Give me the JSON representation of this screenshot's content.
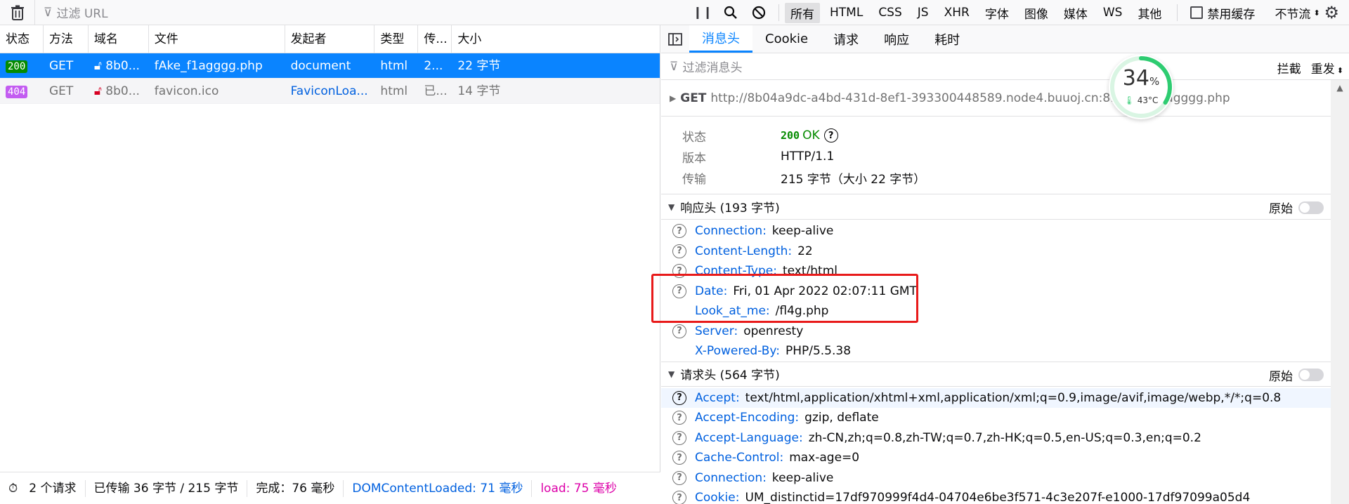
{
  "toolbar": {
    "filter_placeholder": "过滤 URL",
    "type_filters": [
      "所有",
      "HTML",
      "CSS",
      "JS",
      "XHR",
      "字体",
      "图像",
      "媒体",
      "WS",
      "其他"
    ],
    "disable_cache": "禁用缓存",
    "throttle": "不节流"
  },
  "columns": [
    "状态",
    "方法",
    "域名",
    "文件",
    "发起者",
    "类型",
    "传...",
    "大小"
  ],
  "requests": [
    {
      "status": "200",
      "method": "GET",
      "domain": "8b0...",
      "file": "fAke_f1agggg.php",
      "initiator": "document",
      "type": "html",
      "transferred": "2...",
      "size": "22 字节"
    },
    {
      "status": "404",
      "method": "GET",
      "domain": "8b0...",
      "file": "favicon.ico",
      "initiator": "FaviconLoa...",
      "type": "html",
      "transferred": "已...",
      "size": "14 字节"
    }
  ],
  "statusbar": {
    "requests": "2 个请求",
    "transferred": "已传输 36 字节 / 215 字节",
    "finish": "完成：76 毫秒",
    "dcl": "DOMContentLoaded: 71 毫秒",
    "load": "load: 75 毫秒"
  },
  "detail": {
    "tabs": [
      "消息头",
      "Cookie",
      "请求",
      "响应",
      "耗时"
    ],
    "filter_placeholder": "过滤消息头",
    "block_label": "拦截",
    "resend_label": "重发",
    "method": "GET",
    "url": "http://8b04a9dc-a4bd-431d-8ef1-393300448589.node4.buuoj.cn:81/fAke_f1agggg.php",
    "summary": {
      "status_key": "状态",
      "status_code": "200",
      "status_text": "OK",
      "version_key": "版本",
      "version": "HTTP/1.1",
      "transfer_key": "传输",
      "transfer": "215 字节（大小 22 字节）"
    },
    "response_headers_title": "响应头 (193 字节)",
    "raw_label": "原始",
    "response_headers": [
      {
        "name": "Connection:",
        "value": "keep-alive"
      },
      {
        "name": "Content-Length:",
        "value": "22"
      },
      {
        "name": "Content-Type:",
        "value": "text/html"
      },
      {
        "name": "Date:",
        "value": "Fri, 01 Apr 2022 02:07:11 GMT"
      },
      {
        "name": "Look_at_me:",
        "value": "/fl4g.php"
      },
      {
        "name": "Server:",
        "value": "openresty"
      },
      {
        "name": "X-Powered-By:",
        "value": "PHP/5.5.38"
      }
    ],
    "request_headers_title": "请求头 (564 字节)",
    "request_headers": [
      {
        "name": "Accept:",
        "value": "text/html,application/xhtml+xml,application/xml;q=0.9,image/avif,image/webp,*/*;q=0.8"
      },
      {
        "name": "Accept-Encoding:",
        "value": "gzip, deflate"
      },
      {
        "name": "Accept-Language:",
        "value": "zh-CN,zh;q=0.8,zh-TW;q=0.7,zh-HK;q=0.5,en-US;q=0.3,en;q=0.2"
      },
      {
        "name": "Cache-Control:",
        "value": "max-age=0"
      },
      {
        "name": "Connection:",
        "value": "keep-alive"
      },
      {
        "name": "Cookie:",
        "value": "UM_distinctid=17df970999f4d4-04704e6be3f571-4c3e207f-e1000-17df97099a05d4"
      }
    ]
  },
  "gauge": {
    "percent": "34",
    "percent_sign": "%",
    "temp": "43°C",
    "level": 0.34
  },
  "colors": {
    "accent": "#0a84ff",
    "ok": "#058b00",
    "not_found": "#c35cf1",
    "highlight_box": "#e81a1a"
  }
}
